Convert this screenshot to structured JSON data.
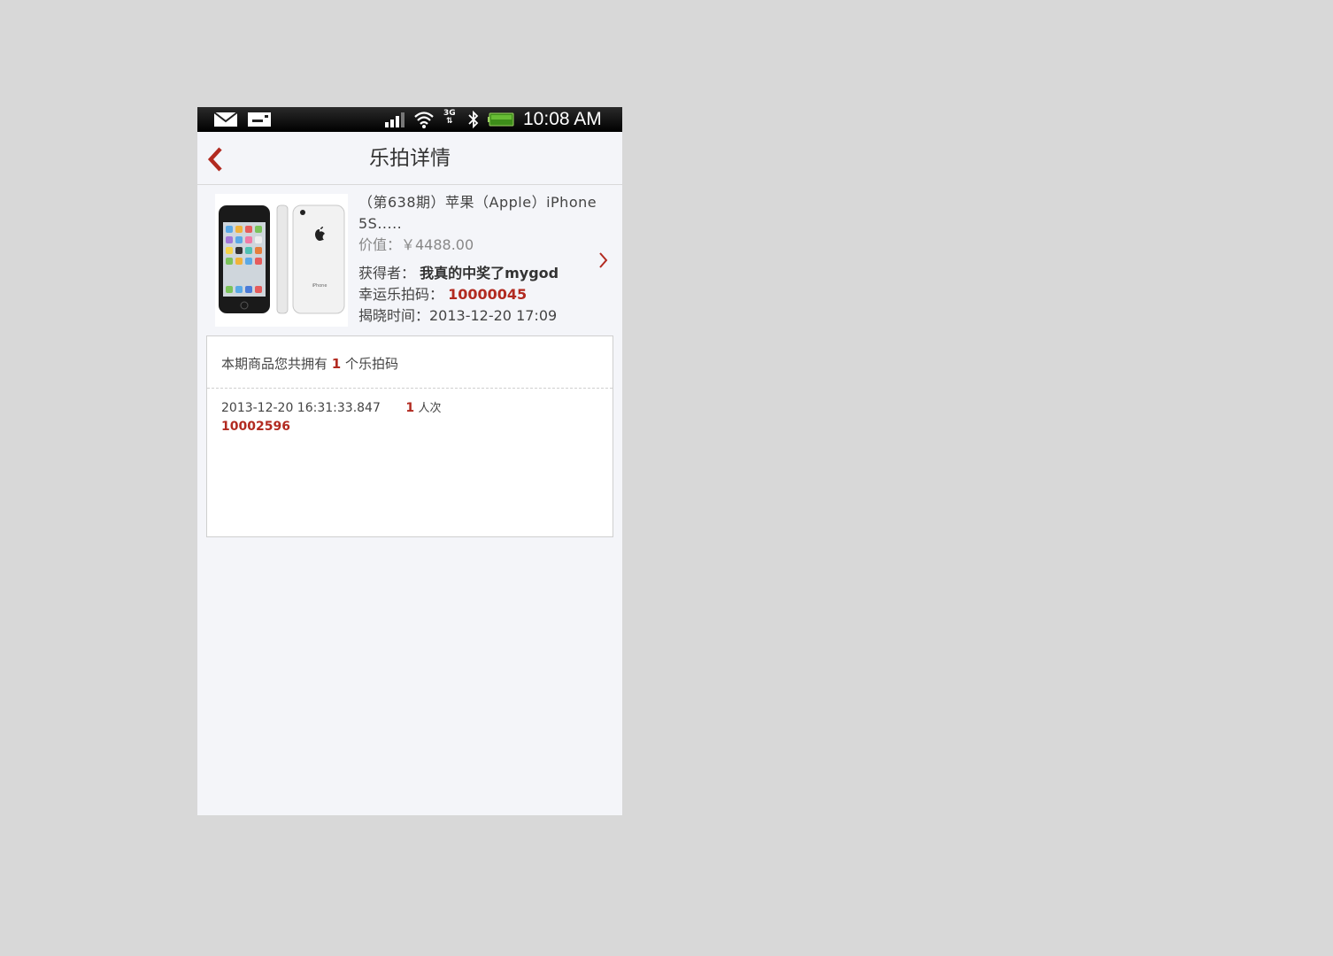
{
  "status_bar": {
    "time": "10:08 AM",
    "network": "3G",
    "icons": [
      "mail-icon",
      "sim-card-icon",
      "signal-icon",
      "wifi-icon",
      "3g-icon",
      "bluetooth-icon",
      "battery-icon"
    ]
  },
  "header": {
    "title": "乐拍详情",
    "back_icon": "chevron-left-icon"
  },
  "product": {
    "name": "（第638期）苹果（Apple）iPhone 5S.....",
    "price": "价值：￥4488.00",
    "winner_label": "获得者：",
    "winner": "我真的中奖了mygod",
    "lucky_code_label": "幸运乐拍码：",
    "lucky_code": "10000045",
    "reveal_time": "揭晓时间：2013-12-20 17:09",
    "image_screen_label": "iPhone"
  },
  "codes": {
    "summary_prefix": "本期商品您共拥有",
    "summary_count": "1",
    "summary_suffix": "个乐拍码",
    "entries": [
      {
        "time": "2013-12-20 16:31:33.847",
        "count": "1",
        "unit": "人次",
        "code": "10002596"
      }
    ]
  },
  "colors": {
    "accent": "#b22a20",
    "background": "#f4f5f9",
    "outer": "#d8d8d8"
  }
}
